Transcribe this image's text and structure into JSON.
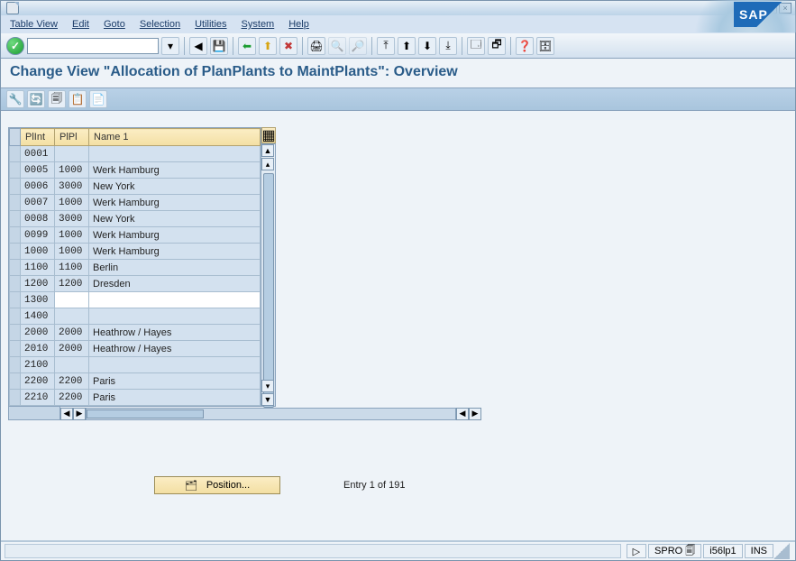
{
  "window_controls": {
    "min": "_",
    "max": "▢",
    "close": "×"
  },
  "menu": [
    "Table View",
    "Edit",
    "Goto",
    "Selection",
    "Utilities",
    "System",
    "Help"
  ],
  "logo": "SAP",
  "toolbar": {
    "check": "✓",
    "back": "◀",
    "save": "💾",
    "back2": "⬅",
    "exit": "⬆",
    "cancel": "✖",
    "print": "🖨",
    "find1": "🔍",
    "find2": "🔎",
    "first": "⤒",
    "prev": "⬆",
    "next": "⬇",
    "last": "⤓",
    "new_mode": "🗔",
    "shortcut": "🗗",
    "help": "❓",
    "custom": "🗄"
  },
  "page_title": "Change View \"Allocation of PlanPlants to MaintPlants\": Overview",
  "action_icons": [
    "🔧",
    "🔄",
    "🗐",
    "📋",
    "📄"
  ],
  "columns": {
    "plnt": "PlInt",
    "plpl": "PlPl",
    "name": "Name 1"
  },
  "rows": [
    {
      "plnt": "0001",
      "plpl": "",
      "name": ""
    },
    {
      "plnt": "0005",
      "plpl": "1000",
      "name": "Werk Hamburg"
    },
    {
      "plnt": "0006",
      "plpl": "3000",
      "name": "New York"
    },
    {
      "plnt": "0007",
      "plpl": "1000",
      "name": "Werk Hamburg"
    },
    {
      "plnt": "0008",
      "plpl": "3000",
      "name": "New York"
    },
    {
      "plnt": "0099",
      "plpl": "1000",
      "name": "Werk Hamburg"
    },
    {
      "plnt": "1000",
      "plpl": "1000",
      "name": "Werk Hamburg"
    },
    {
      "plnt": "1100",
      "plpl": "1100",
      "name": "Berlin"
    },
    {
      "plnt": "1200",
      "plpl": "1200",
      "name": "Dresden"
    },
    {
      "plnt": "1300",
      "plpl": "",
      "name": "",
      "editing": true
    },
    {
      "plnt": "1400",
      "plpl": "",
      "name": ""
    },
    {
      "plnt": "2000",
      "plpl": "2000",
      "name": "Heathrow / Hayes"
    },
    {
      "plnt": "2010",
      "plpl": "2000",
      "name": "Heathrow / Hayes"
    },
    {
      "plnt": "2100",
      "plpl": "",
      "name": ""
    },
    {
      "plnt": "2200",
      "plpl": "2200",
      "name": "Paris"
    },
    {
      "plnt": "2210",
      "plpl": "2200",
      "name": "Paris"
    }
  ],
  "position_btn": "Position...",
  "entry_text": "Entry 1 of 191",
  "status": {
    "tcode": "SPRO",
    "sys": "i56lp1",
    "mode": "INS",
    "arrow": "▷",
    "sheet": "🗐"
  }
}
